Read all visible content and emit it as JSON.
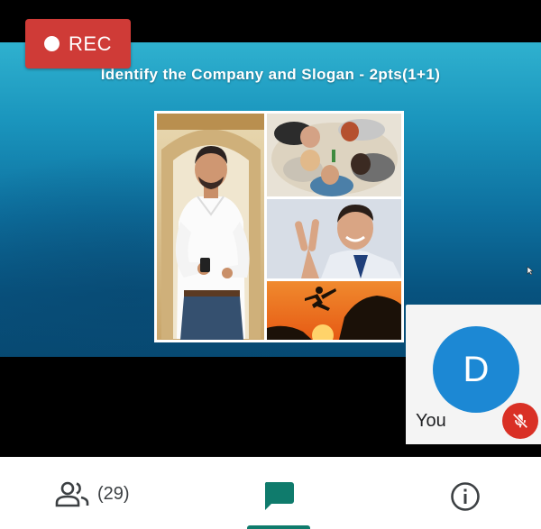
{
  "recording": {
    "label": "REC"
  },
  "slide": {
    "title": "Identify the Company and Slogan - 2pts(1+1)"
  },
  "self_tile": {
    "avatar_initial": "D",
    "name": "You"
  },
  "bottom_bar": {
    "participant_count": "(29)"
  },
  "icons": {
    "people": "people-icon",
    "chat": "chat-icon",
    "info": "info-icon",
    "mic_off": "mic-off-icon"
  },
  "colors": {
    "rec_badge": "#cf3b37",
    "avatar": "#1c88d4",
    "mute": "#d93025",
    "chat_active": "#0f7b6c"
  }
}
